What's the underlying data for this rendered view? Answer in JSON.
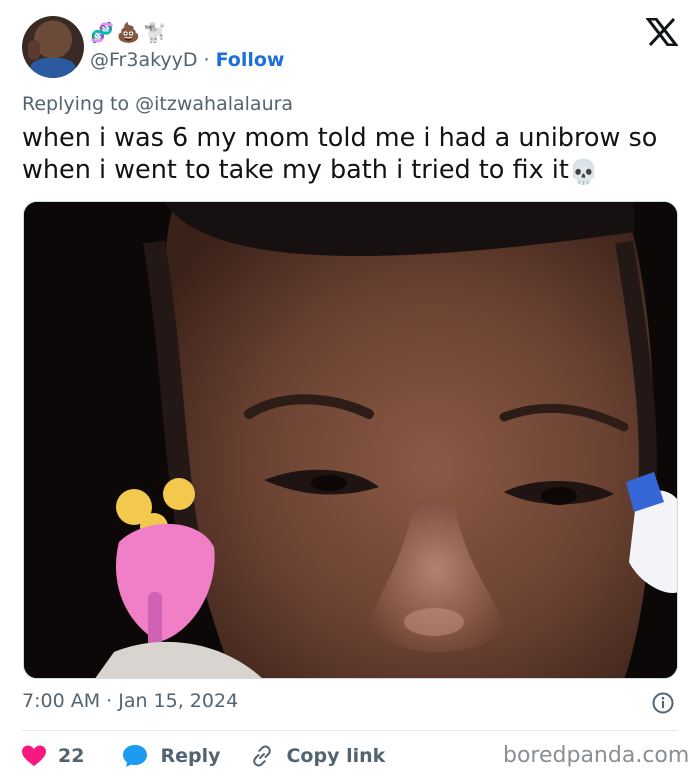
{
  "author": {
    "name_emojis": [
      "🧬",
      "💩",
      "🐩"
    ],
    "handle": "@Fr3akyyD",
    "separator": "·",
    "follow_label": "Follow"
  },
  "reply": {
    "label": "Replying to @itzwahalalaura"
  },
  "tweet": {
    "text": "when i was 6 my mom told me i had a unibrow so when i went to take my bath i tried to fix it",
    "trailing_emoji": "💀"
  },
  "meta": {
    "timestamp": "7:00 AM · Jan 15, 2024"
  },
  "actions": {
    "like_count": "22",
    "reply_label": "Reply",
    "copy_link_label": "Copy link"
  },
  "watermark": "boredpanda.com",
  "colors": {
    "accent": "#1d6fd9",
    "like": "#f91880",
    "reply_icon": "#1d9bf0",
    "secondary_text": "#536471"
  },
  "icons": {
    "platform": "x-logo-icon",
    "info": "info-icon",
    "like": "heart-icon",
    "reply": "speech-bubble-icon",
    "copy": "link-icon"
  }
}
